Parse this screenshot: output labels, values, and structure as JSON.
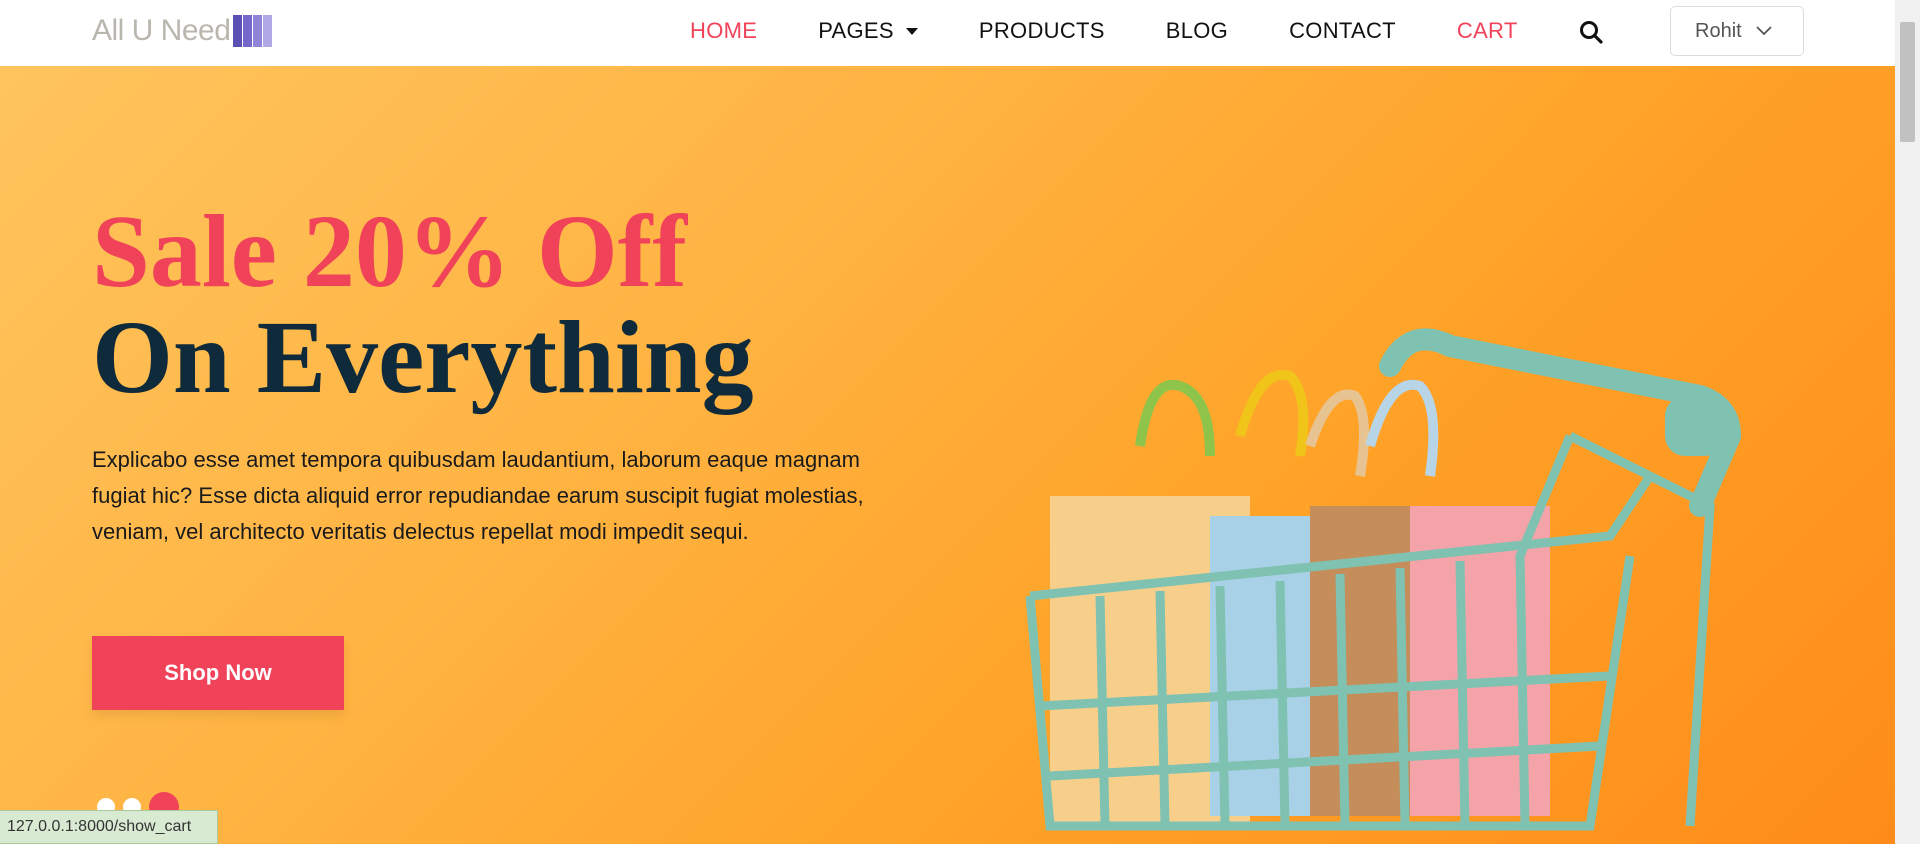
{
  "brand": {
    "name": "All U Need",
    "bar_colors": [
      "#5a4fb3",
      "#7467c9",
      "#8f84d8",
      "#b0a8e6"
    ]
  },
  "nav": {
    "items": [
      {
        "label": "HOME"
      },
      {
        "label": "PAGES"
      },
      {
        "label": "PRODUCTS"
      },
      {
        "label": "BLOG"
      },
      {
        "label": "CONTACT"
      },
      {
        "label": "CART"
      }
    ],
    "search_icon": "search-icon",
    "user": "Rohit"
  },
  "hero": {
    "title_line1": "Sale 20% Off",
    "title_line2": "On Everything",
    "description": "Explicabo esse amet tempora quibusdam laudantium, laborum eaque magnam fugiat hic? Esse dicta aliquid error repudiandae earum suscipit fugiat molestias, veniam, vel architecto veritatis delectus repellat modi impedit sequi.",
    "cta": "Shop Now",
    "slides": 3,
    "active_slide": 3
  },
  "status_bar": {
    "url": "127.0.0.1:8000/show_cart"
  },
  "colors": {
    "accent": "#f0435a",
    "dark": "#0f2a3a",
    "hero_bg": "#ffaa33",
    "cart": "#7fc2b2"
  }
}
